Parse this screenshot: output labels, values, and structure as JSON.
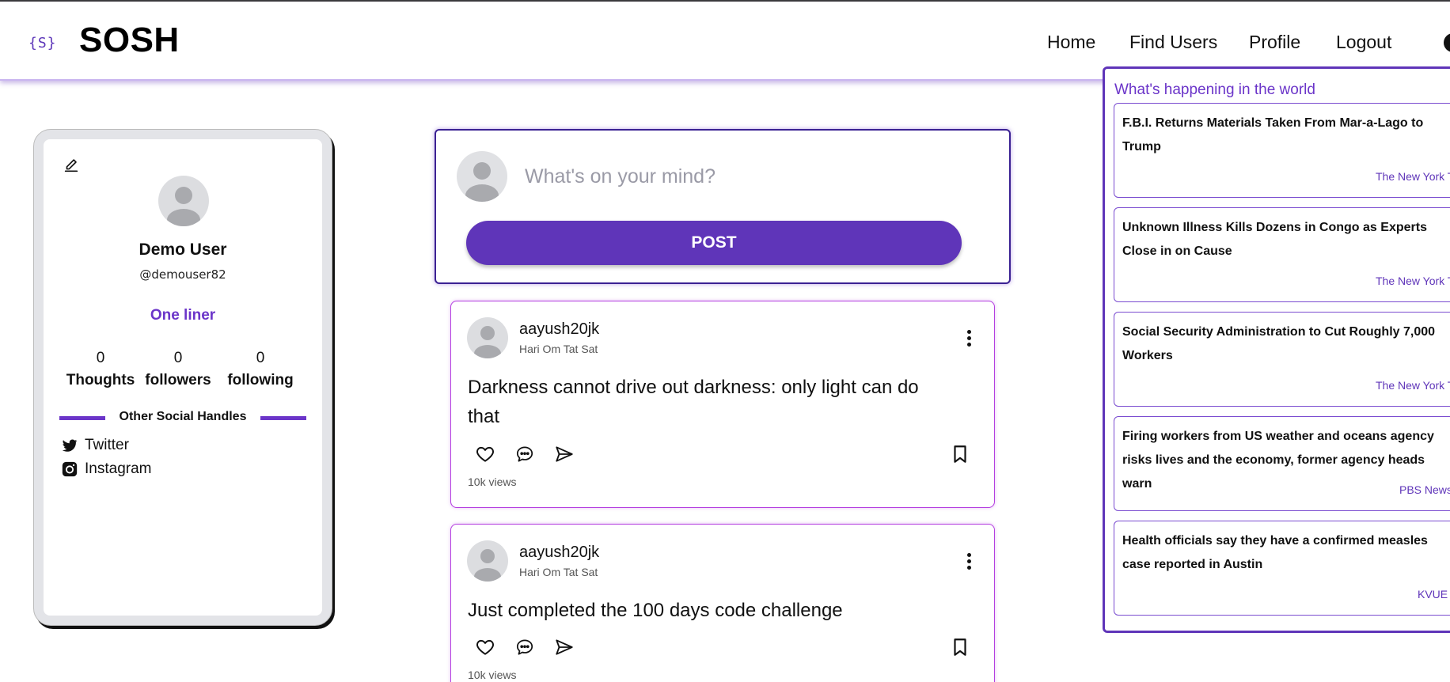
{
  "brand": {
    "mark": "{S}",
    "name": "SOSH"
  },
  "nav": {
    "home": "Home",
    "find_users": "Find Users",
    "profile": "Profile",
    "logout": "Logout"
  },
  "profile": {
    "name": "Demo User",
    "handle": "@demouser82",
    "one_liner": "One liner",
    "stats": [
      {
        "value": "0",
        "label": "Thoughts"
      },
      {
        "value": "0",
        "label": "followers"
      },
      {
        "value": "0",
        "label": "following"
      }
    ],
    "social_title": "Other Social Handles",
    "socials": [
      {
        "label": "Twitter",
        "icon": "twitter-icon"
      },
      {
        "label": "Instagram",
        "icon": "instagram-icon"
      }
    ]
  },
  "composer": {
    "placeholder": "What's on your mind?",
    "post_label": "POST"
  },
  "posts": [
    {
      "username": "aayush20jk",
      "bio": "Hari Om Tat Sat",
      "text": "Darkness cannot drive out darkness: only light can do that",
      "views": "10k views"
    },
    {
      "username": "aayush20jk",
      "bio": "Hari Om Tat Sat",
      "text": "Just completed the 100 days code challenge",
      "views": "10k views"
    }
  ],
  "news": {
    "title": "What's happening in the world",
    "items": [
      {
        "headline": "F.B.I. Returns Materials Taken From Mar-a-Lago to Trump",
        "source": "The New York Times"
      },
      {
        "headline": "Unknown Illness Kills Dozens in Congo as Experts Close in on Cause",
        "source": "The New York Times"
      },
      {
        "headline": "Social Security Administration to Cut Roughly 7,000 Workers",
        "source": "The New York Times"
      },
      {
        "headline": "Firing workers from US weather and oceans agency risks lives and the economy, former agency heads warn",
        "source": "PBS News"
      },
      {
        "headline": "Health officials say they have a confirmed measles case reported in Austin",
        "source": "KVUE"
      }
    ]
  },
  "colors": {
    "accent": "#5f35b9",
    "post_border": "#b43fe0",
    "card_bg": "#e3e4e8"
  }
}
